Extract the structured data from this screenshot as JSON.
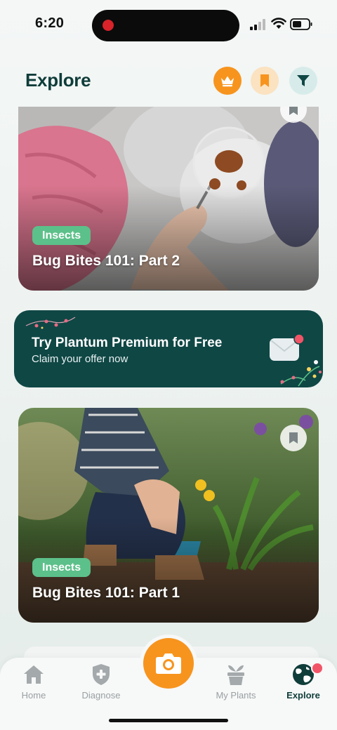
{
  "status_bar": {
    "time": "6:20"
  },
  "header": {
    "title": "Explore",
    "icons": [
      "crown-icon",
      "bookmark-icon",
      "filter-icon"
    ]
  },
  "articles": [
    {
      "tag": "Insects",
      "title": "Bug Bites 101: Part 2"
    },
    {
      "tag": "Insects",
      "title": "Bug Bites 101: Part 1"
    }
  ],
  "promo": {
    "title": "Try Plantum Premium for Free",
    "subtitle": "Claim your offer now"
  },
  "tabbar": {
    "tabs": [
      {
        "label": "Home",
        "icon": "home-icon"
      },
      {
        "label": "Diagnose",
        "icon": "shield-plus-icon"
      },
      {
        "label": "My Plants",
        "icon": "plant-pot-icon"
      },
      {
        "label": "Explore",
        "icon": "globe-icon",
        "active": true
      }
    ],
    "center_icon": "camera-icon"
  },
  "colors": {
    "accent_orange": "#f7941e",
    "primary_dark_green": "#0f3d3a",
    "promo_green": "#0f4745",
    "tag_green": "#5cc08a",
    "notification_red": "#f25467"
  }
}
